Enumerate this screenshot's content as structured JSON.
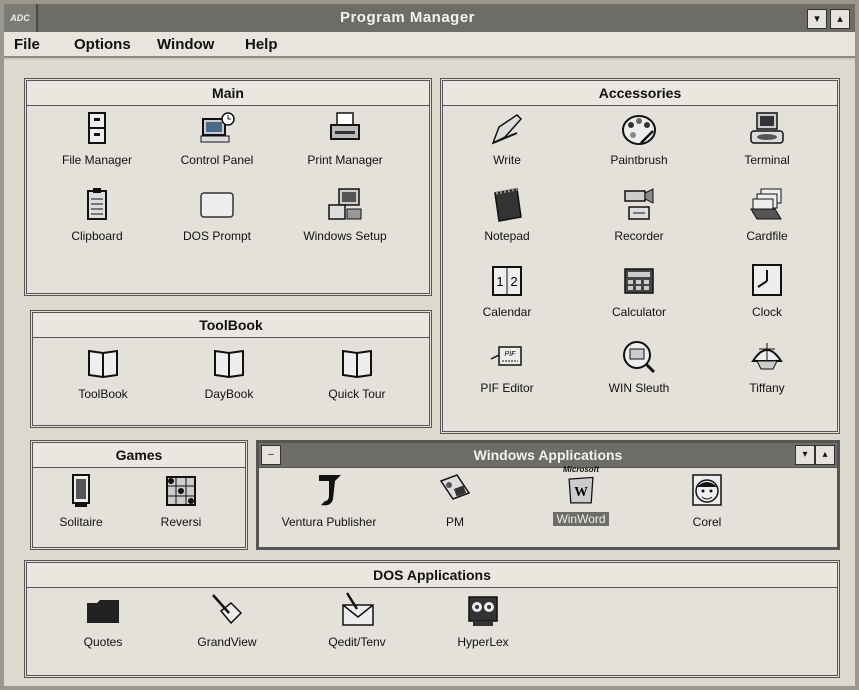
{
  "window": {
    "title": "Program Manager",
    "system_menu_glyph": "ADC"
  },
  "menu": [
    "File",
    "Options",
    "Window",
    "Help"
  ],
  "groups": {
    "main": {
      "title": "Main",
      "items": [
        "File Manager",
        "Control Panel",
        "Print Manager",
        "Clipboard",
        "DOS Prompt",
        "Windows Setup"
      ]
    },
    "accessories": {
      "title": "Accessories",
      "items": [
        "Write",
        "Paintbrush",
        "Terminal",
        "Notepad",
        "Recorder",
        "Cardfile",
        "Calendar",
        "Calculator",
        "Clock",
        "PIF Editor",
        "WIN Sleuth",
        "Tiffany"
      ]
    },
    "toolbook": {
      "title": "ToolBook",
      "items": [
        "ToolBook",
        "DayBook",
        "Quick Tour"
      ]
    },
    "games": {
      "title": "Games",
      "items": [
        "Solitaire",
        "Reversi"
      ]
    },
    "winapps": {
      "title": "Windows Applications",
      "items": [
        "Ventura Publisher",
        "PM",
        "WinWord",
        "Corel"
      ],
      "selected_item": "WinWord",
      "microsoft_badge": "Microsoft"
    },
    "dosapps": {
      "title": "DOS Applications",
      "items": [
        "Quotes",
        "GrandView",
        "Qedit/Tenv",
        "HyperLex"
      ]
    }
  },
  "icons": {
    "main": [
      "file-cabinet-icon",
      "control-panel-icon",
      "printer-icon",
      "clipboard-icon",
      "dos-prompt-icon",
      "windows-setup-icon"
    ],
    "accessories": [
      "write-pen-icon",
      "paint-palette-icon",
      "terminal-icon",
      "notepad-icon",
      "recorder-camera-icon",
      "cardfile-icon",
      "calendar-icon",
      "calculator-icon",
      "clock-icon",
      "pif-editor-icon",
      "magnifier-icon",
      "lamp-icon"
    ],
    "toolbook": [
      "book-icon",
      "book-icon",
      "book-icon"
    ],
    "games": [
      "card-icon",
      "reversi-board-icon"
    ],
    "winapps": [
      "ventura-icon",
      "pm-icon",
      "winword-icon",
      "corel-icon"
    ],
    "dosapps": [
      "folder-icon",
      "pen-diamond-icon",
      "envelope-icon",
      "tape-icon"
    ]
  },
  "buttons": {
    "minimize": "▾",
    "maximize": "▴",
    "restore_menu": "–"
  }
}
